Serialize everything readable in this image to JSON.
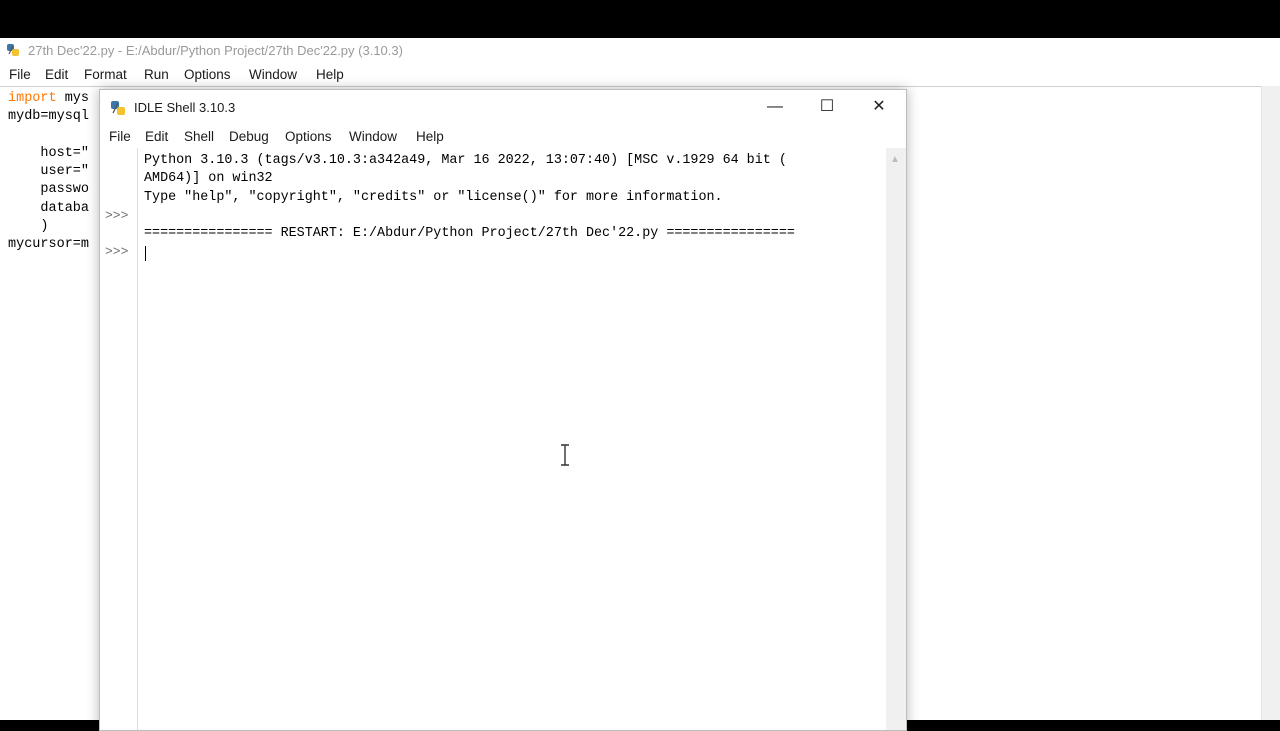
{
  "editor": {
    "title": "27th Dec'22.py - E:/Abdur/Python Project/27th Dec'22.py (3.10.3)",
    "menu": [
      "File",
      "Edit",
      "Format",
      "Run",
      "Options",
      "Window",
      "Help"
    ],
    "code_lines": [
      {
        "kw": "import",
        "rest": " mys"
      },
      {
        "kw": "",
        "rest": "mydb=mysql"
      },
      {
        "kw": "",
        "rest": ""
      },
      {
        "kw": "",
        "rest": "    host=\""
      },
      {
        "kw": "",
        "rest": "    user=\""
      },
      {
        "kw": "",
        "rest": "    passwo"
      },
      {
        "kw": "",
        "rest": "    databa"
      },
      {
        "kw": "",
        "rest": "    )"
      },
      {
        "kw": "",
        "rest": "mycursor=m"
      }
    ]
  },
  "shell": {
    "title": "IDLE Shell 3.10.3",
    "menu": [
      "File",
      "Edit",
      "Shell",
      "Debug",
      "Options",
      "Window",
      "Help"
    ],
    "window_buttons": {
      "minimize": "—",
      "maximize": "☐",
      "close": "✕"
    },
    "prompt": ">>>",
    "lines": [
      "Python 3.10.3 (tags/v3.10.3:a342a49, Mar 16 2022, 13:07:40) [MSC v.1929 64 bit (",
      "AMD64)] on win32",
      "Type \"help\", \"copyright\", \"credits\" or \"license()\" for more information.",
      "",
      "================ RESTART: E:/Abdur/Python Project/27th Dec'22.py ================"
    ]
  }
}
